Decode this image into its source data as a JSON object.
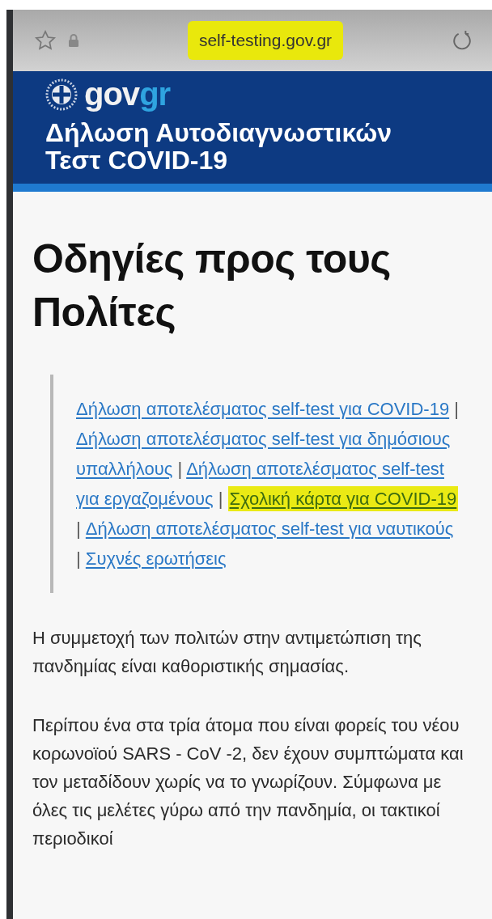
{
  "browser_bar": {
    "url": "self-testing.gov.gr",
    "url_highlighted": true,
    "secure": true
  },
  "header": {
    "logo": {
      "primary": "gov",
      "accent": "gr"
    },
    "title": "Δήλωση Αυτοδιαγνωστικών Τεστ COVID-19"
  },
  "content": {
    "heading": "Οδηγίες προς τους Πολίτες",
    "quick_links": [
      {
        "kind": "link",
        "text": "Δήλωση αποτελέσματος self-test για COVID-19",
        "highlighted": false
      },
      {
        "kind": "separator",
        "text": "|"
      },
      {
        "kind": "link",
        "text": "Δήλωση αποτελέσματος self-test για δημόσιους υπαλλήλους",
        "highlighted": false
      },
      {
        "kind": "separator",
        "text": "|"
      },
      {
        "kind": "link",
        "text": "Δήλωση αποτελέσματος self-test για εργαζομένους",
        "highlighted": false
      },
      {
        "kind": "separator",
        "text": "|"
      },
      {
        "kind": "link",
        "text": "Σχολική κάρτα για COVID-19",
        "highlighted": true
      },
      {
        "kind": "separator",
        "text": "|"
      },
      {
        "kind": "link",
        "text": "Δήλωση αποτελέσματος self-test για ναυτικούς",
        "highlighted": false
      },
      {
        "kind": "separator",
        "text": "|"
      },
      {
        "kind": "link",
        "text": "Συχνές ερωτήσεις",
        "highlighted": false
      }
    ],
    "paragraphs": [
      "Η συμμετοχή των πολιτών στην αντιμετώπιση της πανδημίας είναι καθοριστικής σημασίας.",
      "Περίπου ένα στα τρία άτομα που είναι φορείς του νέου κορωνοϊού SARS - CoV -2, δεν έχουν συμπτώματα και τον μεταδίδουν χωρίς να το γνωρίζουν. Σύμφωνα με όλες τις μελέτες γύρω από την πανδημία, οι τακτικοί περιοδικοί"
    ]
  }
}
